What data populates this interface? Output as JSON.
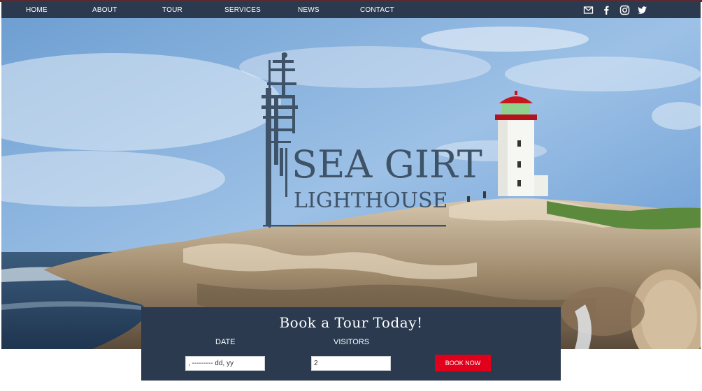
{
  "nav": {
    "items": [
      {
        "id": "home",
        "label": "HOME"
      },
      {
        "id": "about",
        "label": "ABOUT"
      },
      {
        "id": "tour",
        "label": "TOUR"
      },
      {
        "id": "services",
        "label": "SERVICES"
      },
      {
        "id": "news",
        "label": "NEWS"
      },
      {
        "id": "contact",
        "label": "CONTACT"
      }
    ],
    "social": [
      "mail-icon",
      "facebook-icon",
      "instagram-icon",
      "twitter-icon"
    ]
  },
  "hero": {
    "logo_line1": "SEA GIRT",
    "logo_line2": "LIGHTHOUSE",
    "logo_color": "#3e5268"
  },
  "booking": {
    "title": "Book a Tour Today!",
    "date_label": "DATE",
    "visitors_label": "VISITORS",
    "date_value": ", --------- dd, yy",
    "visitors_value": "2",
    "button_label": "BOOK NOW",
    "button_color": "#e0001b",
    "panel_color": "#2b3a4f"
  }
}
